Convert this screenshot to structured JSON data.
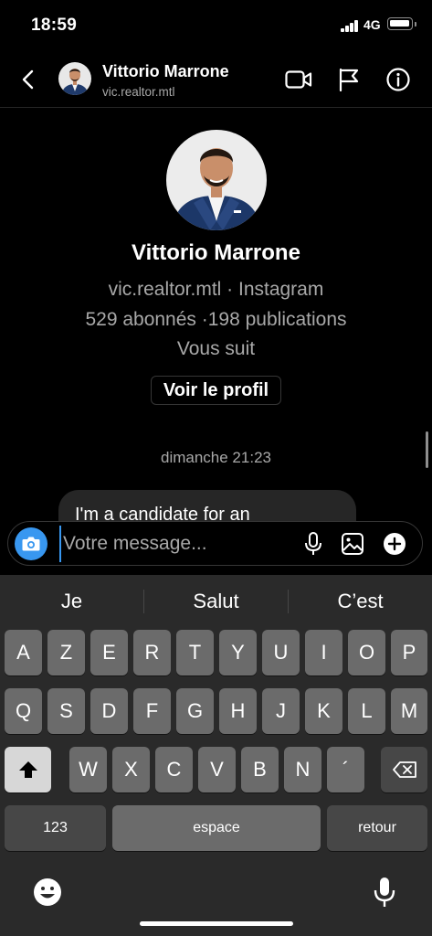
{
  "status_bar": {
    "time": "18:59",
    "network": "4G"
  },
  "header": {
    "name": "Vittorio Marrone",
    "username": "vic.realtor.mtl",
    "icons": [
      "back-icon",
      "video-call-icon",
      "flag-icon",
      "info-icon"
    ]
  },
  "profile": {
    "name": "Vittorio Marrone",
    "account_line": "vic.realtor.mtl · Instagram",
    "stats_line": "529 abonnés ·198 publications",
    "follow_status": "Vous suit",
    "view_profile_label": "Voir le profil"
  },
  "conversation": {
    "timestamp": "dimanche 21:23",
    "messages": [
      {
        "text": "I'm a candidate for an"
      }
    ]
  },
  "composer": {
    "placeholder": "Votre message...",
    "icons": [
      "camera-icon",
      "microphone-icon",
      "gallery-icon",
      "plus-icon"
    ]
  },
  "keyboard": {
    "suggestions": [
      "Je",
      "Salut",
      "C’est"
    ],
    "row1": [
      "A",
      "Z",
      "E",
      "R",
      "T",
      "Y",
      "U",
      "I",
      "O",
      "P"
    ],
    "row2": [
      "Q",
      "S",
      "D",
      "F",
      "G",
      "H",
      "J",
      "K",
      "L",
      "M"
    ],
    "row3": [
      "W",
      "X",
      "C",
      "V",
      "B",
      "N",
      "´"
    ],
    "numbers_label": "123",
    "space_label": "espace",
    "return_label": "retour"
  },
  "colors": {
    "accent": "#3897f0",
    "bubble": "#262626",
    "keyboard_bg": "#2a2a2a",
    "key": "#6b6b6b"
  }
}
